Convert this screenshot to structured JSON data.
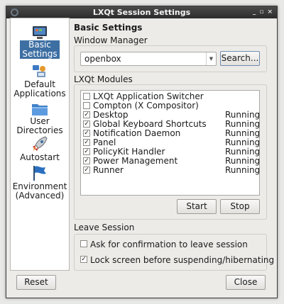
{
  "window": {
    "title": "LXQt Session Settings",
    "controls": [
      "_",
      "▫",
      "×"
    ]
  },
  "sidebar": {
    "items": [
      {
        "label_lines": [
          "Basic",
          "Settings"
        ],
        "selected": true,
        "icon": "monitor-icon"
      },
      {
        "label_lines": [
          "Default",
          "Applications"
        ],
        "selected": false,
        "icon": "applications-icon"
      },
      {
        "label_lines": [
          "User",
          "Directories"
        ],
        "selected": false,
        "icon": "folder-icon"
      },
      {
        "label_lines": [
          "Autostart"
        ],
        "selected": false,
        "icon": "rocket-icon"
      },
      {
        "label_lines": [
          "Environment",
          "(Advanced)"
        ],
        "selected": false,
        "icon": "flag-icon"
      }
    ]
  },
  "main": {
    "heading": "Basic Settings",
    "window_manager": {
      "label": "Window Manager",
      "value": "openbox",
      "search_label": "Search..."
    },
    "modules": {
      "label": "LXQt Modules",
      "rows": [
        {
          "name": "LXQt Application Switcher",
          "checked": false,
          "status": ""
        },
        {
          "name": "Compton (X Compositor)",
          "checked": false,
          "status": ""
        },
        {
          "name": "Desktop",
          "checked": true,
          "status": "Running"
        },
        {
          "name": "Global Keyboard Shortcuts",
          "checked": true,
          "status": "Running"
        },
        {
          "name": "Notification Daemon",
          "checked": true,
          "status": "Running"
        },
        {
          "name": "Panel",
          "checked": true,
          "status": "Running"
        },
        {
          "name": "PolicyKit Handler",
          "checked": true,
          "status": "Running"
        },
        {
          "name": "Power Management",
          "checked": true,
          "status": "Running"
        },
        {
          "name": "Runner",
          "checked": true,
          "status": "Running"
        }
      ],
      "start_label": "Start",
      "stop_label": "Stop"
    },
    "leave_session": {
      "label": "Leave Session",
      "ask_confirmation": {
        "text": "Ask for confirmation to leave session",
        "checked": false
      },
      "lock_screen": {
        "text": "Lock screen before suspending/hibernating",
        "checked": true
      }
    }
  },
  "footer": {
    "reset_label": "Reset",
    "close_label": "Close"
  },
  "colors": {
    "selection": "#3d6fa3",
    "titlebar": "#2c2c2c"
  }
}
